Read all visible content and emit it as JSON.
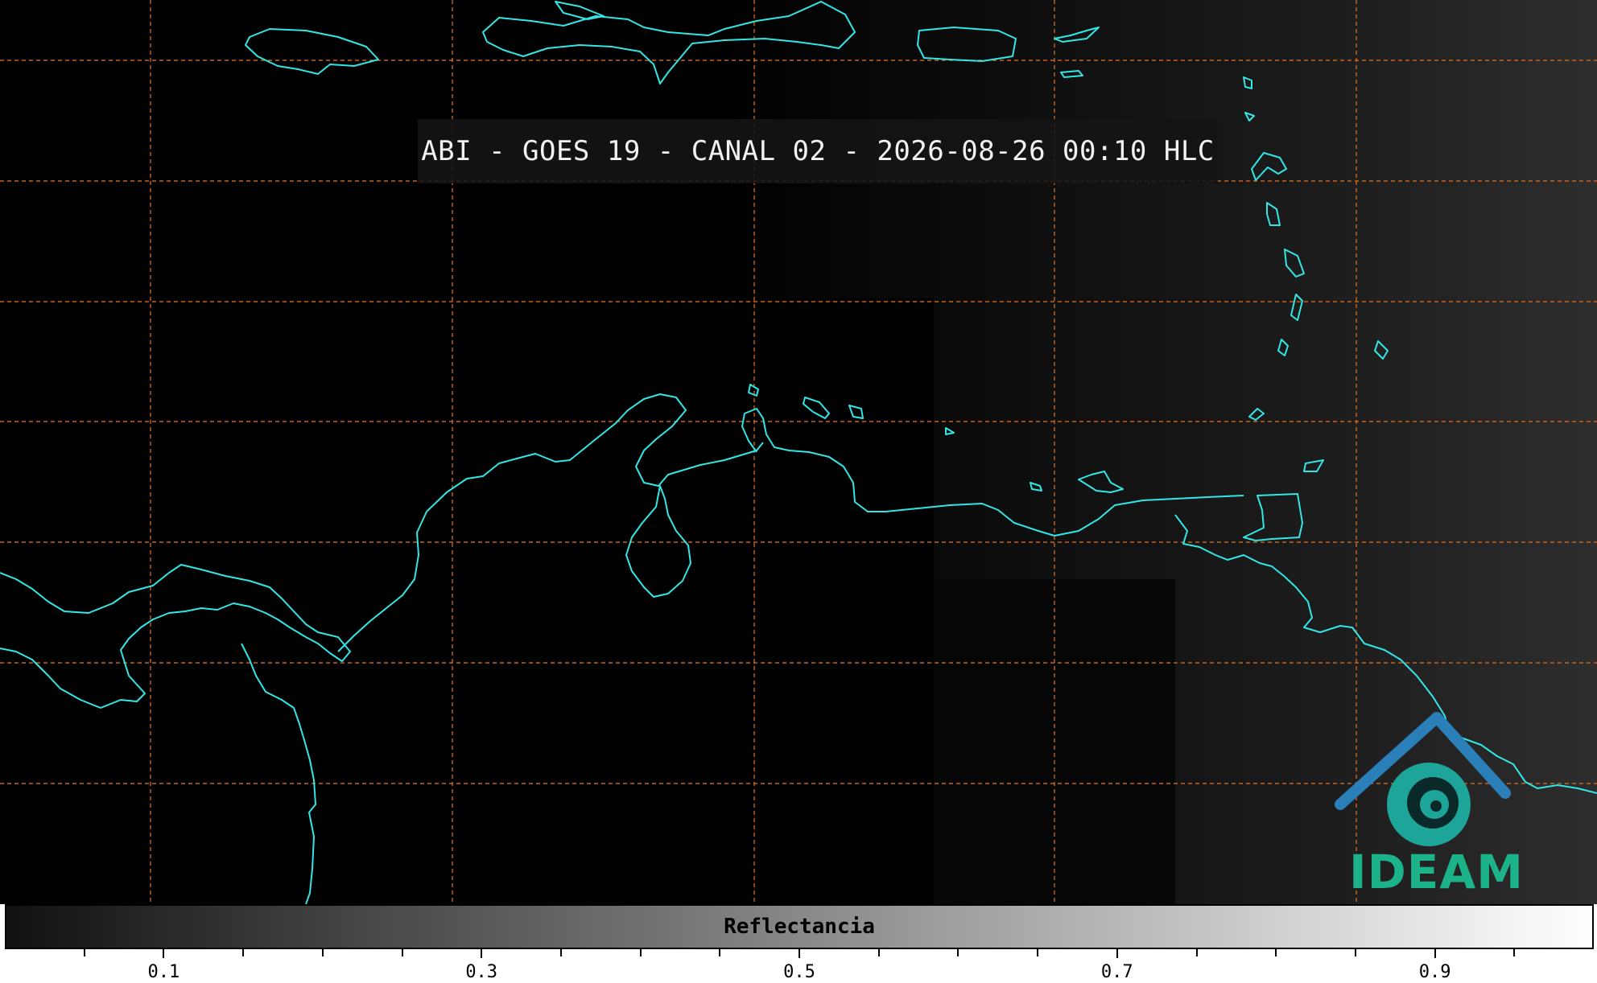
{
  "title": "ABI - GOES 19 - CANAL 02 - 2026-08-26 00:10 HLC",
  "colorbar": {
    "label": "Reflectancia",
    "range": [
      0.0,
      1.0
    ],
    "major_ticks": [
      {
        "value": 0.1,
        "label": "0.1"
      },
      {
        "value": 0.3,
        "label": "0.3"
      },
      {
        "value": 0.5,
        "label": "0.5"
      },
      {
        "value": 0.7,
        "label": "0.7"
      },
      {
        "value": 0.9,
        "label": "0.9"
      }
    ],
    "minor_ticks": [
      0.05,
      0.15,
      0.2,
      0.25,
      0.35,
      0.4,
      0.45,
      0.55,
      0.6,
      0.65,
      0.75,
      0.8,
      0.85,
      0.95
    ],
    "gradient": [
      "#111111",
      "#ffffff"
    ]
  },
  "logo": {
    "text": "IDEAM",
    "text_color": "#1db38a",
    "roof_color": "#2b7fb8",
    "swirl_color": "#1ea59a"
  },
  "colors": {
    "coastline": "#33e6e6",
    "gridline": "#c8641e",
    "background": "#000000"
  }
}
